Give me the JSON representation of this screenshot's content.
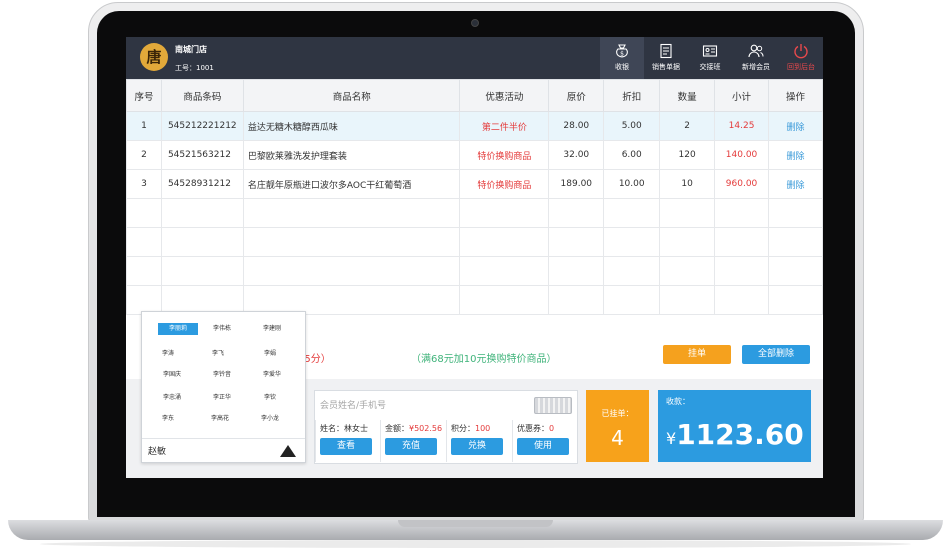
{
  "header": {
    "logo_text": "唐",
    "store_name": "南城门店",
    "staff_id": "工号：1001",
    "buttons": [
      {
        "label": "收银",
        "icon": "money-bag-icon"
      },
      {
        "label": "销售单据",
        "icon": "receipt-icon"
      },
      {
        "label": "交接班",
        "icon": "id-card-icon"
      },
      {
        "label": "新增会员",
        "icon": "add-member-icon"
      },
      {
        "label": "回到后台",
        "icon": "power-icon"
      }
    ]
  },
  "table": {
    "columns": [
      "序号",
      "商品条码",
      "商品名称",
      "优惠活动",
      "原价",
      "折扣",
      "数量",
      "小计",
      "操作"
    ],
    "rows": [
      {
        "no": "1",
        "code": "545212221212",
        "name": "益达无糖木糖醇西瓜味",
        "promo": "第二件半价",
        "price": "28.00",
        "discount": "5.00",
        "qty": "2",
        "subtotal": "14.25",
        "action": "删除"
      },
      {
        "no": "2",
        "code": "54521563212",
        "name": "巴黎欧莱雅洗发护理套装",
        "promo": "特价换购商品",
        "price": "32.00",
        "discount": "6.00",
        "qty": "120",
        "subtotal": "140.00",
        "action": "删除"
      },
      {
        "no": "3",
        "code": "54528931212",
        "name": "名庄靓年原瓶进口波尔多AOC干红葡萄酒",
        "promo": "特价换购商品",
        "price": "189.00",
        "discount": "10.00",
        "qty": "10",
        "subtotal": "960.00",
        "action": "删除"
      }
    ]
  },
  "promo": {
    "prefix": "45分）",
    "text": "（满68元加10元换购特价商品）",
    "hang_label": "挂单",
    "delete_all_label": "全部删除"
  },
  "member": {
    "placeholder": "会员姓名/手机号",
    "name_label": "姓名：",
    "name_value": "林女士",
    "balance_label": "金额：",
    "balance_value": "¥502.56",
    "points_label": "积分：",
    "points_value": "100",
    "coupon_label": "优惠券：",
    "coupon_value": "0",
    "view_label": "查看",
    "recharge_label": "充值",
    "redeem_label": "兑换",
    "use_label": "使用"
  },
  "hung": {
    "label": "已挂单：",
    "count": "4"
  },
  "total": {
    "label": "收款：",
    "currency": "¥",
    "amount": "1123.60"
  },
  "suggest": {
    "names": [
      "李丽莉",
      "李伟栋",
      "李建刚",
      "李涛",
      "李飞",
      "李娟",
      "李国庆",
      "李钤音",
      "李爱华",
      "李忠涌",
      "李正华",
      "李钦",
      "李东",
      "李高花",
      "李小龙"
    ],
    "value": "赵敏"
  },
  "colors": {
    "topbar": "#2f3542",
    "accent_blue": "#2c9be0",
    "accent_orange": "#f7a21b",
    "red": "#e43b3b",
    "green": "#3fb37a"
  }
}
